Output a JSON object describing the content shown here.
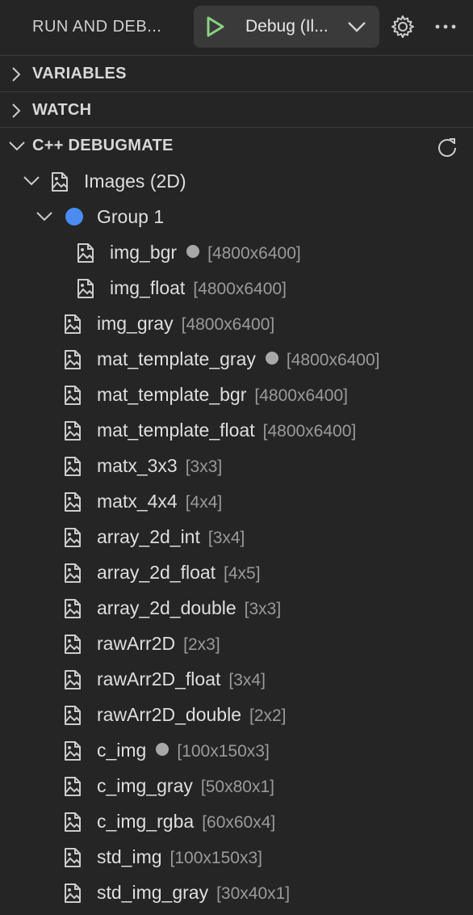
{
  "header": {
    "title": "RUN AND DEB...",
    "config_label": "Debug (Il...",
    "accent_green": "#89d185"
  },
  "sections": {
    "variables": "VARIABLES",
    "watch": "WATCH",
    "debugmate": "C++ DEBUGMATE"
  },
  "tree": {
    "root_label": "Images (2D)",
    "group_label": "Group 1",
    "group_color": "#4a8cf0",
    "group_items": [
      {
        "name": "img_bgr",
        "dim": "[4800x6400]",
        "dot": true
      },
      {
        "name": "img_float",
        "dim": "[4800x6400]",
        "dot": false
      }
    ],
    "items": [
      {
        "name": "img_gray",
        "dim": "[4800x6400]",
        "dot": false
      },
      {
        "name": "mat_template_gray",
        "dim": "[4800x6400]",
        "dot": true
      },
      {
        "name": "mat_template_bgr",
        "dim": "[4800x6400]",
        "dot": false
      },
      {
        "name": "mat_template_float",
        "dim": "[4800x6400]",
        "dot": false
      },
      {
        "name": "matx_3x3",
        "dim": "[3x3]",
        "dot": false
      },
      {
        "name": "matx_4x4",
        "dim": "[4x4]",
        "dot": false
      },
      {
        "name": "array_2d_int",
        "dim": "[3x4]",
        "dot": false
      },
      {
        "name": "array_2d_float",
        "dim": "[4x5]",
        "dot": false
      },
      {
        "name": "array_2d_double",
        "dim": "[3x3]",
        "dot": false
      },
      {
        "name": "rawArr2D",
        "dim": "[2x3]",
        "dot": false
      },
      {
        "name": "rawArr2D_float",
        "dim": "[3x4]",
        "dot": false
      },
      {
        "name": "rawArr2D_double",
        "dim": "[2x2]",
        "dot": false
      },
      {
        "name": "c_img",
        "dim": "[100x150x3]",
        "dot": true
      },
      {
        "name": "c_img_gray",
        "dim": "[50x80x1]",
        "dot": false
      },
      {
        "name": "c_img_rgba",
        "dim": "[60x60x4]",
        "dot": false
      },
      {
        "name": "std_img",
        "dim": "[100x150x3]",
        "dot": false
      },
      {
        "name": "std_img_gray",
        "dim": "[30x40x1]",
        "dot": false
      }
    ]
  }
}
